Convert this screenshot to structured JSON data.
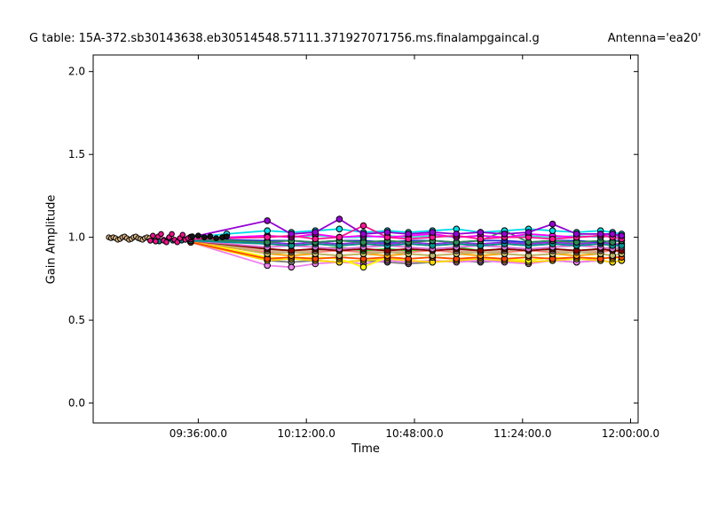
{
  "figure": {
    "title_left": "G table: 15A-372.sb30143638.eb30514548.57111.371927071756.ms.finalampgaincal.g",
    "title_right": "Antenna='ea20'"
  },
  "chart_data": {
    "type": "line",
    "title": "G table: 15A-372.sb30143638.eb30514548.57111.371927071756.ms.finalampgaincal.g",
    "annotation": "Antenna='ea20'",
    "xlabel": "Time",
    "ylabel": "Gain Amplitude",
    "grid": false,
    "legend": false,
    "marker": "circle",
    "x_axis": {
      "unit": "minutes after 09:00:00",
      "xlim": [
        1.0,
        182.5
      ],
      "tick_minutes": [
        36,
        72,
        108,
        144,
        180
      ],
      "tick_labels": [
        "09:36:00.0",
        "10:12:00.0",
        "10:48:00.0",
        "11:24:00.0",
        "12:00:00.0"
      ]
    },
    "y_axis": {
      "ylim": [
        -0.12,
        2.1
      ],
      "ticks": [
        0.0,
        0.5,
        1.0,
        1.5,
        2.0
      ],
      "tick_labels": [
        "0.0",
        "0.5",
        "1.0",
        "1.5",
        "2.0"
      ]
    },
    "t_main": [
      33.5,
      59,
      67,
      75,
      83,
      91,
      99,
      106,
      114,
      122,
      130,
      138,
      146,
      154,
      162,
      170,
      174,
      177
    ],
    "series": [
      {
        "name": "gray",
        "color": "#808080",
        "t": "main",
        "values": [
          0.98,
          0.86,
          0.85,
          0.86,
          0.85,
          0.86,
          0.85,
          0.84,
          0.85,
          0.86,
          0.85,
          0.86,
          0.85,
          0.86,
          0.85,
          0.86,
          0.85,
          0.86
        ]
      },
      {
        "name": "violet",
        "color": "#ee82ee",
        "t": "main",
        "values": [
          0.97,
          0.83,
          0.82,
          0.84,
          0.85,
          0.84,
          0.86,
          0.85,
          0.86,
          0.85,
          0.86,
          0.85,
          0.84,
          0.86,
          0.85,
          0.86,
          0.85,
          0.86
        ]
      },
      {
        "name": "gold",
        "color": "#ffd700",
        "t": "main",
        "values": [
          0.97,
          0.86,
          0.87,
          0.86,
          0.85,
          0.86,
          0.87,
          0.86,
          0.85,
          0.86,
          0.87,
          0.86,
          0.85,
          0.86,
          0.87,
          0.86,
          0.85,
          0.86
        ]
      },
      {
        "name": "yellow",
        "color": "#ffff00",
        "t": "main",
        "values": [
          0.98,
          0.88,
          0.87,
          0.88,
          0.87,
          0.82,
          0.88,
          0.87,
          0.88,
          0.87,
          0.88,
          0.87,
          0.86,
          0.88,
          0.87,
          0.88,
          0.87,
          0.88
        ]
      },
      {
        "name": "orangered",
        "color": "#ff4500",
        "t": "main",
        "values": [
          0.97,
          0.87,
          0.88,
          0.87,
          0.88,
          0.87,
          0.88,
          0.87,
          0.88,
          0.87,
          0.88,
          0.87,
          0.88,
          0.87,
          0.88,
          0.87,
          0.88,
          0.88
        ]
      },
      {
        "name": "orange",
        "color": "#ffa500",
        "t": "main",
        "values": [
          0.98,
          0.9,
          0.89,
          0.9,
          0.89,
          0.9,
          0.89,
          0.9,
          0.89,
          0.9,
          0.89,
          0.9,
          0.89,
          0.9,
          0.89,
          0.9,
          0.89,
          0.9
        ]
      },
      {
        "name": "salmon",
        "color": "#fa8072",
        "t": "main",
        "values": [
          0.98,
          0.91,
          0.92,
          0.91,
          0.92,
          0.91,
          0.92,
          0.91,
          0.92,
          0.91,
          0.92,
          0.91,
          0.92,
          0.91,
          0.92,
          0.91,
          0.92,
          0.91
        ]
      },
      {
        "name": "darkkhaki",
        "color": "#bdb76b",
        "t": "main",
        "values": [
          0.99,
          0.9,
          0.91,
          0.9,
          0.89,
          0.9,
          0.91,
          0.9,
          0.89,
          0.9,
          0.91,
          0.9,
          0.89,
          0.9,
          0.91,
          0.9,
          0.89,
          0.9
        ]
      },
      {
        "name": "tan",
        "color": "#d2b48c",
        "t": "main",
        "values": [
          0.99,
          0.92,
          0.91,
          0.92,
          0.93,
          0.92,
          0.91,
          0.92,
          0.93,
          0.92,
          0.91,
          0.92,
          0.93,
          0.92,
          0.91,
          0.92,
          0.93,
          0.92
        ]
      },
      {
        "name": "limegreen",
        "color": "#32cd32",
        "t": "main",
        "values": [
          0.98,
          0.93,
          0.92,
          0.93,
          0.94,
          0.92,
          0.93,
          0.92,
          0.93,
          0.94,
          0.92,
          0.93,
          0.92,
          0.93,
          0.92,
          0.93,
          0.94,
          0.93
        ]
      },
      {
        "name": "darkred",
        "color": "#8b0000",
        "t": "main",
        "values": [
          0.98,
          0.93,
          0.92,
          0.93,
          0.92,
          0.93,
          0.92,
          0.93,
          0.92,
          0.93,
          0.92,
          0.93,
          0.92,
          0.93,
          0.92,
          0.93,
          0.92,
          0.92
        ]
      },
      {
        "name": "red",
        "color": "#dd2222",
        "t": "main",
        "values": [
          0.99,
          0.96,
          0.95,
          0.96,
          0.95,
          0.96,
          0.95,
          0.96,
          0.95,
          0.96,
          0.95,
          0.96,
          0.95,
          0.96,
          0.95,
          0.96,
          0.95,
          0.96
        ]
      },
      {
        "name": "orchid",
        "color": "#da70d6",
        "t": "main",
        "values": [
          0.98,
          0.94,
          0.95,
          0.94,
          0.93,
          0.94,
          0.95,
          0.94,
          0.93,
          0.94,
          0.95,
          0.94,
          0.93,
          0.94,
          0.95,
          0.94,
          0.93,
          0.94
        ]
      },
      {
        "name": "blueviolet",
        "color": "#8a2be2",
        "t": "main",
        "values": [
          0.99,
          0.97,
          0.96,
          0.97,
          0.96,
          0.97,
          0.96,
          0.97,
          0.96,
          0.97,
          0.96,
          0.97,
          0.96,
          0.97,
          0.96,
          0.97,
          0.96,
          0.96
        ]
      },
      {
        "name": "teal",
        "color": "#009393",
        "t": "main",
        "values": [
          0.98,
          0.96,
          0.95,
          0.96,
          0.95,
          0.96,
          0.95,
          0.96,
          0.95,
          0.96,
          0.95,
          0.96,
          0.95,
          0.96,
          0.95,
          0.96,
          0.95,
          0.95
        ]
      },
      {
        "name": "blue",
        "color": "#2233cc",
        "t": "main",
        "values": [
          0.99,
          0.98,
          0.98,
          0.97,
          0.98,
          0.98,
          0.97,
          0.98,
          0.98,
          0.97,
          0.98,
          0.98,
          0.97,
          0.98,
          0.98,
          0.97,
          0.98,
          0.98
        ]
      },
      {
        "name": "seagreen",
        "color": "#2e8b57",
        "t": "main",
        "values": [
          0.99,
          0.97,
          0.98,
          0.97,
          0.98,
          0.97,
          0.98,
          0.97,
          0.98,
          0.97,
          0.98,
          1.04,
          0.97,
          0.98,
          0.97,
          0.98,
          0.97,
          0.98
        ]
      },
      {
        "name": "turquoise",
        "color": "#40e0d0",
        "t": "main",
        "values": [
          0.99,
          1.01,
          1.0,
          1.01,
          1.0,
          1.0,
          1.01,
          1.0,
          1.01,
          1.0,
          1.01,
          1.0,
          1.01,
          1.0,
          1.01,
          1.0,
          1.01,
          1.0
        ]
      },
      {
        "name": "magenta",
        "color": "#ff00ff",
        "t": "main",
        "values": [
          0.99,
          1.01,
          1.0,
          1.02,
          1.0,
          1.01,
          1.0,
          1.01,
          1.02,
          1.0,
          1.01,
          1.0,
          1.02,
          1.01,
          1.0,
          1.01,
          1.02,
          1.0
        ]
      },
      {
        "name": "cyan",
        "color": "#00dce8",
        "t": [
          33.5,
          45.5,
          59,
          67,
          75,
          83,
          91,
          99,
          106,
          114,
          122,
          130,
          138,
          146,
          154,
          162,
          170,
          174,
          177
        ],
        "values": [
          1.0,
          1.02,
          1.04,
          1.03,
          1.04,
          1.05,
          1.03,
          1.04,
          1.03,
          1.04,
          1.05,
          1.03,
          1.04,
          1.05,
          1.04,
          1.03,
          1.04,
          1.03,
          1.02
        ]
      },
      {
        "name": "deeppink",
        "color": "#ff1493",
        "t": "main",
        "values": [
          0.99,
          1.0,
          1.01,
          0.99,
          1.0,
          1.07,
          1.0,
          0.99,
          1.0,
          1.01,
          0.99,
          1.0,
          1.0,
          0.99,
          1.0,
          1.01,
          1.0,
          0.99
        ]
      },
      {
        "name": "purple",
        "color": "#9400d3",
        "t": "main",
        "values": [
          1.0,
          1.1,
          1.02,
          1.03,
          1.11,
          1.02,
          1.03,
          1.02,
          1.03,
          1.02,
          1.03,
          1.02,
          1.03,
          1.08,
          1.02,
          1.02,
          1.02,
          1.01
        ]
      },
      {
        "name": "teal-cal",
        "color": "#007d7d",
        "r": 2.7,
        "lw": 1.2,
        "t": [
          20,
          21.5,
          23,
          24.5,
          26,
          27.5,
          29,
          30.5,
          32
        ],
        "values": [
          0.985,
          0.98,
          0.975,
          0.985,
          0.99,
          0.98,
          0.975,
          0.98,
          0.988
        ]
      },
      {
        "name": "burlywood-cal",
        "color": "#deb887",
        "r": 2.7,
        "lw": 1.2,
        "t": [
          6.2,
          6.95,
          7.7,
          8.45,
          9.2,
          9.95,
          10.7,
          11.45,
          12.2,
          12.95,
          13.7,
          14.45,
          15.2,
          15.95,
          16.7,
          17.45,
          18.2,
          18.95,
          19.7
        ],
        "values": [
          1.0,
          0.995,
          1.0,
          0.995,
          0.985,
          0.99,
          1.0,
          1.005,
          0.995,
          0.985,
          0.99,
          1.0,
          1.005,
          0.995,
          0.99,
          0.985,
          0.995,
          1.0,
          0.995
        ]
      },
      {
        "name": "magenta-cal",
        "color": "#ee1289",
        "r": 2.8,
        "lw": 1.2,
        "t": [
          20,
          20.9,
          21.8,
          22.7,
          23.6,
          24.5,
          25.4,
          26.3,
          27.2,
          28.1,
          29,
          29.9,
          30.8,
          31.7,
          32.6,
          33.5
        ],
        "values": [
          0.98,
          1.01,
          0.975,
          1.005,
          1.02,
          0.98,
          0.97,
          1.0,
          1.02,
          0.985,
          0.97,
          0.995,
          1.015,
          0.985,
          0.995,
          1.0
        ]
      },
      {
        "name": "black-cal",
        "color": "#141414",
        "r": 2.9,
        "lw": 1.2,
        "t": [
          34,
          36,
          38,
          40,
          42,
          44,
          45.5
        ],
        "values": [
          1.005,
          1.01,
          1.0,
          1.005,
          0.995,
          1.0,
          1.005
        ]
      }
    ]
  }
}
